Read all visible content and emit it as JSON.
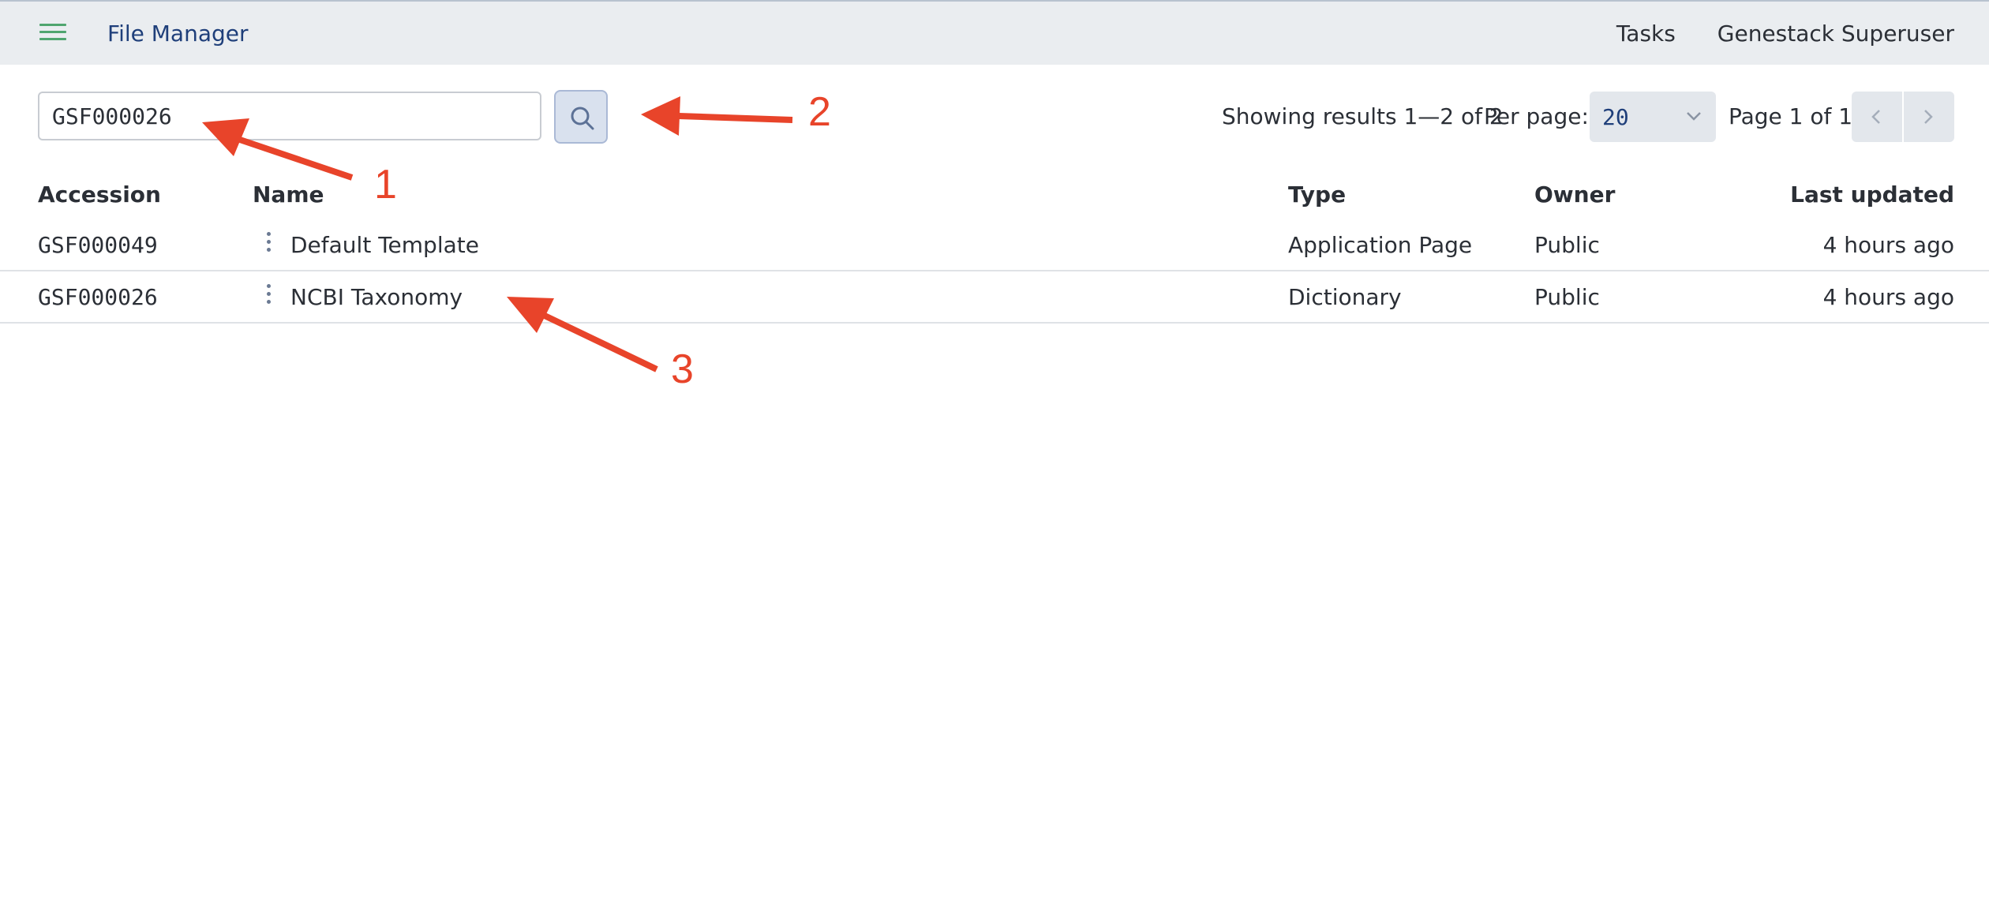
{
  "header": {
    "app_title": "File Manager",
    "nav": [
      "Tasks",
      "Genestack Superuser"
    ]
  },
  "search": {
    "value": "GSF000026",
    "placeholder": ""
  },
  "pagination": {
    "results_text": "Showing results 1—2 of 2",
    "per_page_label": "Per page:",
    "per_page_value": "20",
    "page_text": "Page 1 of 1"
  },
  "table": {
    "columns": [
      "Accession",
      "Name",
      "Type",
      "Owner",
      "Last updated"
    ],
    "rows": [
      {
        "accession": "GSF000049",
        "name": "Default Template",
        "type": "Application Page",
        "owner": "Public",
        "updated": "4 hours ago"
      },
      {
        "accession": "GSF000026",
        "name": "NCBI Taxonomy",
        "type": "Dictionary",
        "owner": "Public",
        "updated": "4 hours ago"
      }
    ]
  },
  "annotations": [
    "1",
    "2",
    "3"
  ],
  "colors": {
    "accent": "#1f3f7a",
    "annotation": "#e8442a",
    "menu_icon": "#4fa56f"
  },
  "icons": [
    "menu-icon",
    "search-icon",
    "chevron-down-icon",
    "chevron-left-icon",
    "chevron-right-icon",
    "kebab-icon"
  ]
}
